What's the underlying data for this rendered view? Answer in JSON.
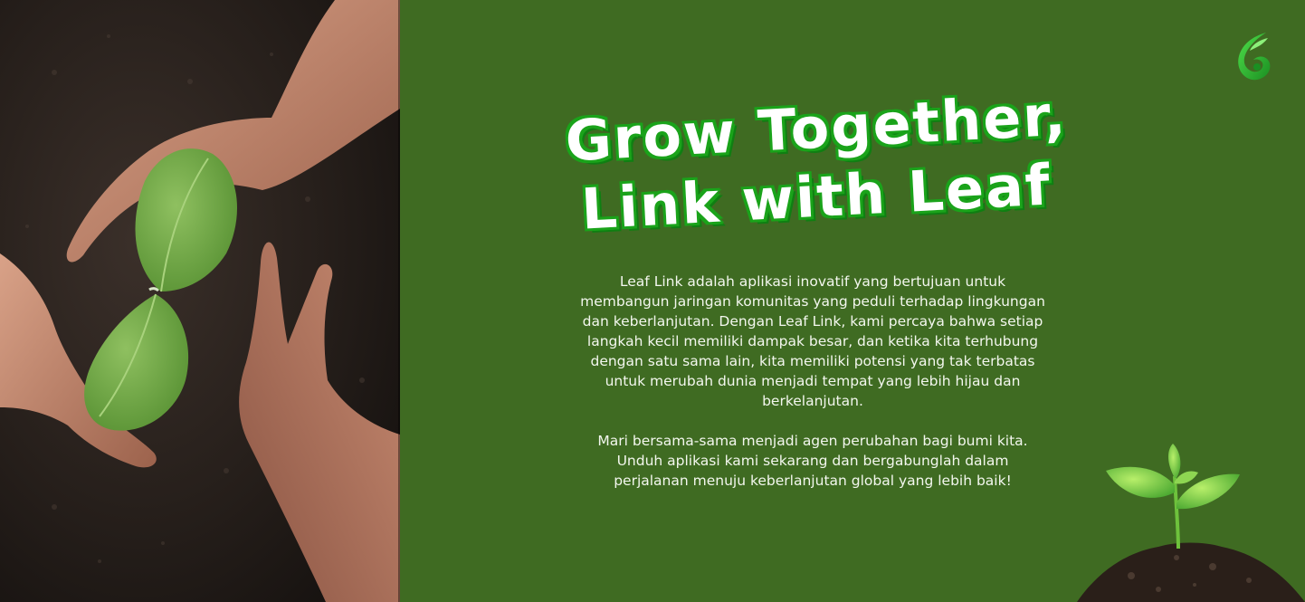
{
  "hero": {
    "headline_line1": "Grow Together,",
    "headline_line2": "Link with Leaf"
  },
  "description": {
    "paragraph1": "Leaf Link adalah aplikasi inovatif yang bertujuan untuk membangun jaringan komunitas yang peduli terhadap lingkungan dan keberlanjutan.  Dengan Leaf Link, kami percaya bahwa setiap langkah kecil memiliki dampak besar, dan ketika kita terhubung dengan satu sama lain, kita memiliki potensi yang tak terbatas untuk merubah dunia menjadi tempat yang lebih hijau dan berkelanjutan.",
    "paragraph2": "Mari bersama-sama menjadi agen perubahan bagi bumi kita. Unduh aplikasi kami sekarang dan bergabunglah dalam perjalanan menuju keberlanjutan global yang lebih baik!"
  },
  "icons": {
    "logo": "leaf-logo-icon",
    "photo": "hands-seedling-photo",
    "sprout": "sprout-soil-illustration"
  },
  "colors": {
    "background": "#3f6b22",
    "headline_outline": "#1aa31a",
    "text": "#f3f7ee"
  }
}
